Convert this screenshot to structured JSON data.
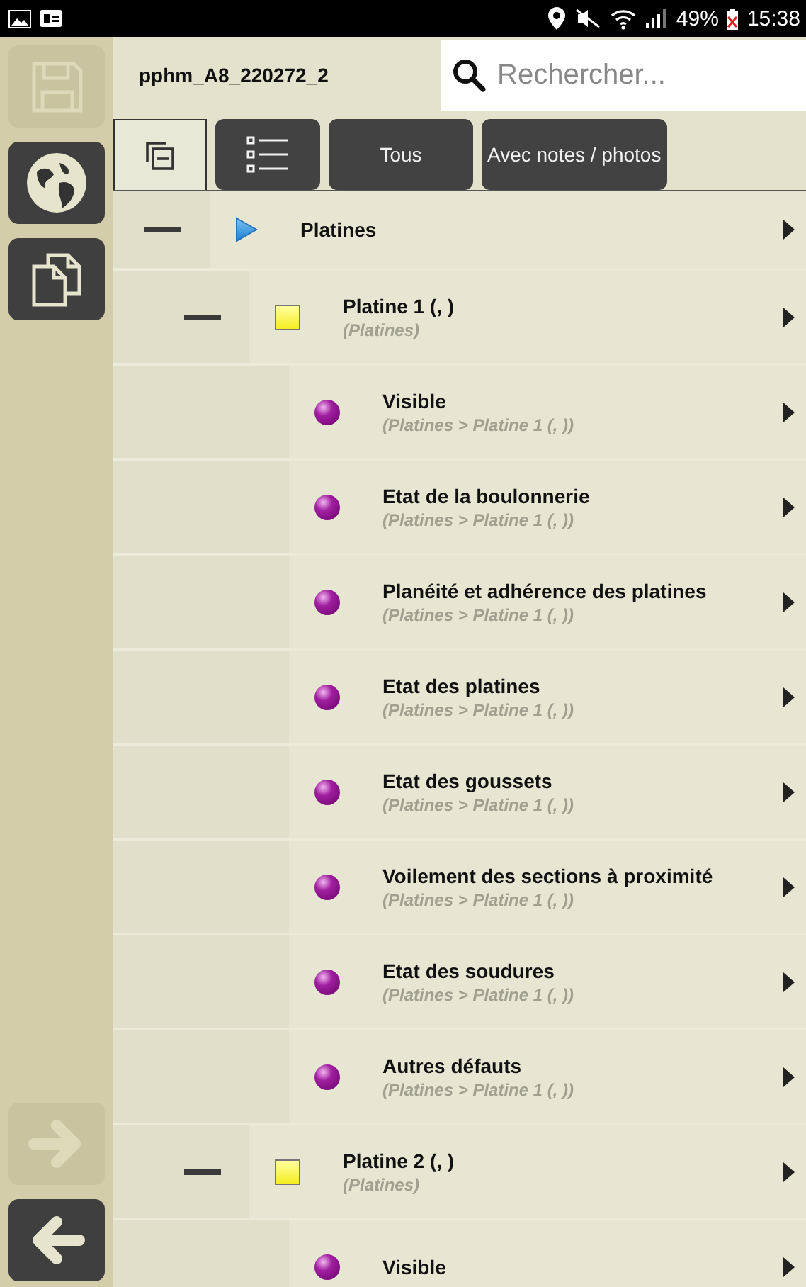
{
  "status_bar": {
    "battery": "49%",
    "time": "15:38"
  },
  "sidebar": {
    "items": [
      {
        "kind": "save",
        "disabled": true
      },
      {
        "kind": "globe",
        "disabled": false
      },
      {
        "kind": "copy",
        "disabled": false
      }
    ],
    "bottom_items": [
      {
        "kind": "forward",
        "disabled": true
      },
      {
        "kind": "back",
        "disabled": false
      }
    ]
  },
  "header": {
    "title": "pphm_A8_220272_2",
    "search": {
      "placeholder": "Rechercher..."
    }
  },
  "filters": [
    {
      "kind": "collapse",
      "selected": true
    },
    {
      "kind": "list",
      "selected": false
    },
    {
      "kind": "text",
      "label": "Tous",
      "selected": false
    },
    {
      "kind": "text",
      "label": "Avec notes / photos",
      "selected": false
    }
  ],
  "tree": [
    {
      "kind": "category",
      "title": "Platines",
      "expanded": true,
      "children": [
        {
          "kind": "element",
          "title": "Platine 1 (, )",
          "subtitle": "(Platines)",
          "expanded": true,
          "children": [
            {
              "kind": "check",
              "title": "Visible",
              "subtitle": "(Platines > Platine 1 (, ))"
            },
            {
              "kind": "check",
              "title": "Etat de la boulonnerie",
              "subtitle": "(Platines > Platine 1 (, ))"
            },
            {
              "kind": "check",
              "title": "Planéité et adhérence des platines",
              "subtitle": "(Platines > Platine 1 (, ))"
            },
            {
              "kind": "check",
              "title": "Etat des platines",
              "subtitle": "(Platines > Platine 1 (, ))"
            },
            {
              "kind": "check",
              "title": "Etat des goussets",
              "subtitle": "(Platines > Platine 1 (, ))"
            },
            {
              "kind": "check",
              "title": "Voilement des sections à proximité",
              "subtitle": "(Platines > Platine 1 (, ))"
            },
            {
              "kind": "check",
              "title": "Etat des soudures",
              "subtitle": "(Platines > Platine 1 (, ))"
            },
            {
              "kind": "check",
              "title": "Autres défauts",
              "subtitle": "(Platines > Platine 1 (, ))"
            }
          ]
        },
        {
          "kind": "element",
          "title": "Platine 2 (, )",
          "subtitle": "(Platines)",
          "expanded": true,
          "children": [
            {
              "kind": "check",
              "title": "Visible"
            }
          ]
        }
      ]
    }
  ]
}
